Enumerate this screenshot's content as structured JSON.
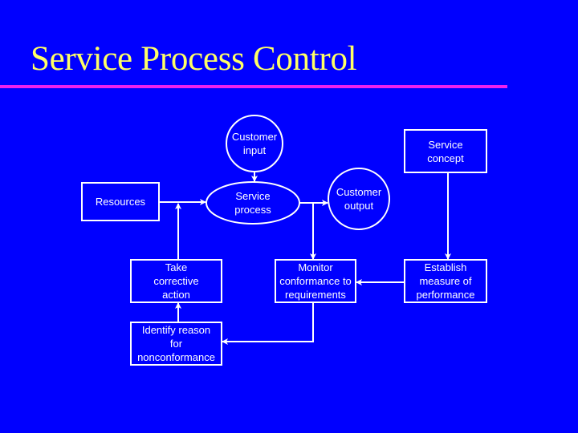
{
  "title": "Service Process Control",
  "colors": {
    "background": "#0000FF",
    "title": "#FFFF66",
    "rule": "#EE22EE",
    "stroke": "#FFFFFF"
  },
  "nodes": {
    "customer_input": {
      "label": "Customer\ninput",
      "shape": "circle"
    },
    "service_concept": {
      "label": "Service\nconcept",
      "shape": "rectangle"
    },
    "resources": {
      "label": "Resources",
      "shape": "rectangle"
    },
    "service_process": {
      "label": "Service\nprocess",
      "shape": "ellipse"
    },
    "customer_output": {
      "label": "Customer\noutput",
      "shape": "circle"
    },
    "take_corrective_action": {
      "label": "Take\ncorrective\naction",
      "shape": "rectangle"
    },
    "monitor_conformance": {
      "label": "Monitor\nconformance to\nrequirements",
      "shape": "rectangle"
    },
    "establish_measure": {
      "label": "Establish\nmeasure of\nperformance",
      "shape": "rectangle"
    },
    "identify_reason": {
      "label": "Identify reason\nfor\nnonconformance",
      "shape": "rectangle"
    }
  },
  "edges": [
    {
      "from": "customer_input",
      "to": "service_process"
    },
    {
      "from": "resources",
      "to": "service_process"
    },
    {
      "from": "take_corrective_action",
      "to": "service_process"
    },
    {
      "from": "service_process",
      "to": "customer_output"
    },
    {
      "from": "service_process",
      "to": "monitor_conformance"
    },
    {
      "from": "service_concept",
      "to": "establish_measure"
    },
    {
      "from": "establish_measure",
      "to": "monitor_conformance"
    },
    {
      "from": "monitor_conformance",
      "to": "identify_reason"
    },
    {
      "from": "identify_reason",
      "to": "take_corrective_action"
    }
  ]
}
